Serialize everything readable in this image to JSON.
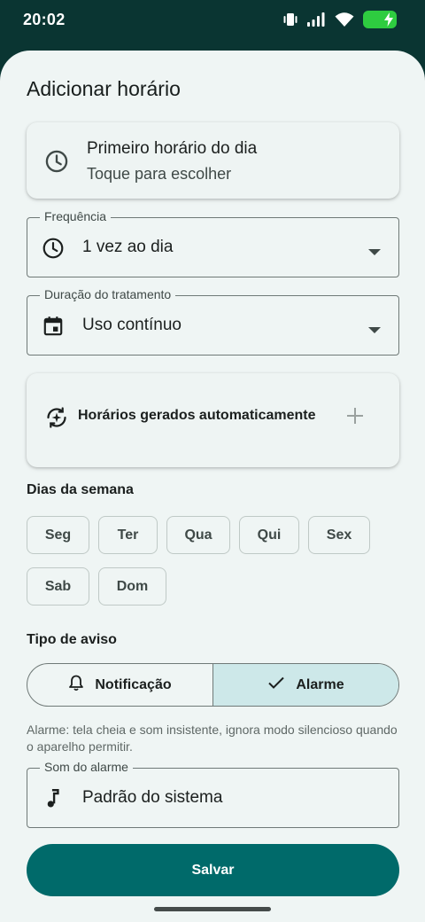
{
  "status_bar": {
    "time": "20:02"
  },
  "sheet": {
    "title": "Adicionar horário"
  },
  "first_time": {
    "title": "Primeiro horário do dia",
    "subtitle": "Toque para escolher"
  },
  "frequency": {
    "label": "Frequência",
    "value": "1 vez ao dia"
  },
  "duration": {
    "label": "Duração do tratamento",
    "value": "Uso contínuo"
  },
  "auto_times": {
    "title": "Horários gerados automaticamente"
  },
  "weekdays": {
    "label": "Dias da semana",
    "days": [
      "Seg",
      "Ter",
      "Qua",
      "Qui",
      "Sex",
      "Sab",
      "Dom"
    ]
  },
  "alert_type": {
    "label": "Tipo de aviso",
    "options": [
      "Notificação",
      "Alarme"
    ],
    "selected": "Alarme",
    "help": "Alarme: tela cheia e som insistente, ignora modo silencioso quando o aparelho permitir."
  },
  "alarm_sound": {
    "label": "Som do alarme",
    "value": "Padrão do sistema"
  },
  "actions": {
    "save_label": "Salvar"
  },
  "icons": {
    "status": [
      "vibrate-icon",
      "signal-icon",
      "wifi-icon",
      "battery-charging-icon"
    ],
    "first_time": "clock-icon",
    "frequency": "clock-icon",
    "duration": "calendar-icon",
    "auto_times": "auto-refresh-sparkle-icon",
    "auto_times_action": "plus-icon",
    "notification": "bell-icon",
    "alarm": "check-icon",
    "sound": "music-note-icon",
    "dropdown": "caret-down-icon"
  },
  "colors": {
    "header_background": "#0a3532",
    "sheet_background": "#eff5f4",
    "primary": "#006a6a",
    "selected_segment": "#cde8e9",
    "battery": "#2ecc40"
  }
}
